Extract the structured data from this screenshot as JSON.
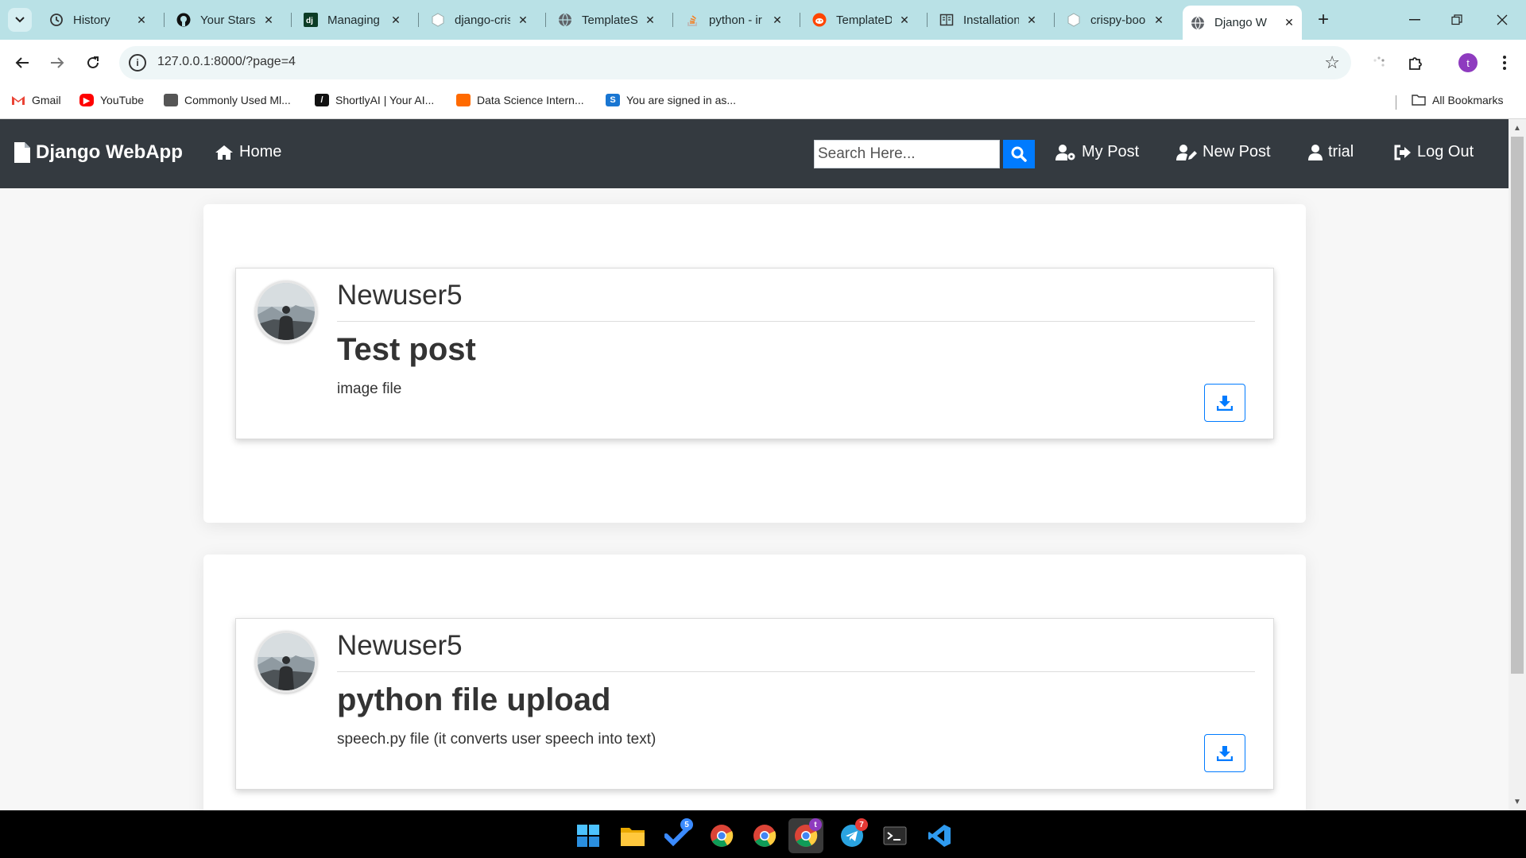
{
  "browser": {
    "tabs": [
      {
        "title": "History",
        "icon": "history-icon"
      },
      {
        "title": "Your Stars",
        "icon": "github-icon"
      },
      {
        "title": "Managing",
        "icon": "django-icon"
      },
      {
        "title": "django-cris",
        "icon": "cube-icon"
      },
      {
        "title": "TemplateS",
        "icon": "globe-icon"
      },
      {
        "title": "python - ir",
        "icon": "stackoverflow-icon"
      },
      {
        "title": "TemplateD",
        "icon": "reddit-icon"
      },
      {
        "title": "Installation",
        "icon": "book-icon"
      },
      {
        "title": "crispy-boo",
        "icon": "cube-icon"
      },
      {
        "title": "Django W",
        "icon": "globe-icon",
        "active": true
      }
    ],
    "new_tab": "+",
    "url": "127.0.0.1:8000/?page=4",
    "profile_initial": "t",
    "bookmarks": [
      {
        "label": "Gmail",
        "color": "#ea4335"
      },
      {
        "label": "YouTube",
        "color": "#ff0000"
      },
      {
        "label": "Commonly Used Ml...",
        "color": "#555555"
      },
      {
        "label": "ShortlyAI | Your AI...",
        "color": "#111111"
      },
      {
        "label": "Data Science Intern...",
        "color": "#ff6a00"
      },
      {
        "label": "You are signed in as...",
        "color": "#1976d2"
      }
    ],
    "all_bookmarks": "All Bookmarks"
  },
  "navbar": {
    "brand": "Django WebApp",
    "home": "Home",
    "search_placeholder": "Search Here...",
    "my_post": "My Post",
    "new_post": "New Post",
    "user": "trial",
    "logout": "Log Out",
    "bg_color": "#343a40",
    "accent_color": "#007bff"
  },
  "posts": [
    {
      "author": "Newuser5",
      "title": "Test post",
      "body": "image file"
    },
    {
      "author": "Newuser5",
      "title": "python file upload",
      "body": "speech.py file (it converts user speech into text)"
    }
  ],
  "taskbar": {
    "badges": {
      "todo": "5",
      "chrome_active": "t",
      "telegram": "7"
    }
  }
}
